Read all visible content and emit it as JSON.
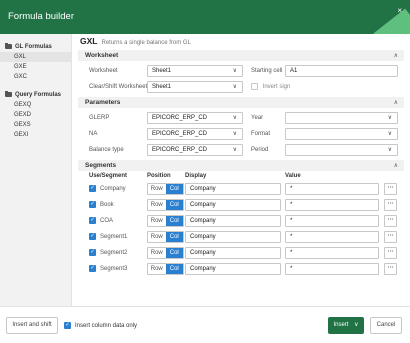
{
  "header": {
    "title": "Formula builder",
    "close_glyph": "×"
  },
  "sidebar": {
    "sections": [
      {
        "label": "GL Formulas",
        "items": [
          "GXL",
          "GXE",
          "GXC"
        ]
      },
      {
        "label": "Query Formulas",
        "items": [
          "GEXQ",
          "GEXD",
          "GEXS",
          "GEXI"
        ]
      }
    ]
  },
  "function": {
    "name": "GXL",
    "description": "Returns a single balance from GL"
  },
  "worksheet": {
    "title": "Worksheet",
    "worksheet_label": "Worksheet",
    "worksheet_value": "Sheet1",
    "starting_cell_label": "Starting cell",
    "starting_cell_value": "A1",
    "clear_shift_label": "Clear/Shift Worksheet",
    "clear_shift_value": "Sheet1",
    "invert_sign_label": "Invert sign"
  },
  "parameters": {
    "title": "Parameters",
    "glerp_label": "GLERP",
    "glerp_value": "EPICORC_ERP_CD",
    "na_label": "NA",
    "na_value": "EPICORC_ERP_CD",
    "balance_type_label": "Balance type",
    "balance_type_value": "EPICORC_ERP_CD",
    "year_label": "Year",
    "format_label": "Format",
    "period_label": "Period"
  },
  "segments": {
    "title": "Segments",
    "columns": {
      "use": "Use/Segment",
      "position": "Position",
      "display": "Display",
      "value": "Value"
    },
    "row_label": "Row",
    "col_label": "Col",
    "more_glyph": "···",
    "rows": [
      {
        "segment": "Company",
        "display": "Company",
        "value": "*"
      },
      {
        "segment": "Book",
        "display": "Company",
        "value": "*"
      },
      {
        "segment": "COA",
        "display": "Company",
        "value": "*"
      },
      {
        "segment": "Segment1",
        "display": "Company",
        "value": "*"
      },
      {
        "segment": "Segment2",
        "display": "Company",
        "value": "*"
      },
      {
        "segment": "Segment3",
        "display": "Company",
        "value": "*"
      }
    ]
  },
  "footer": {
    "insert_shift_label": "Insert and shift",
    "insert_column_label": "Insert column data only",
    "insert_label": "Insert",
    "cancel_label": "Cancel"
  },
  "colors": {
    "brand": "#217346",
    "accent": "#2a7fd0"
  }
}
